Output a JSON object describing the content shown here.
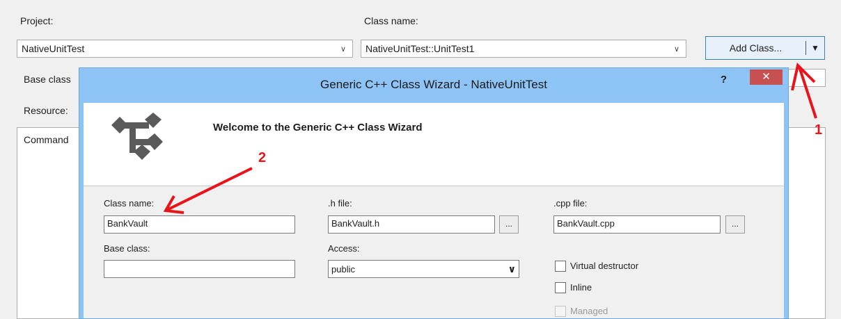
{
  "background": {
    "project_label": "Project:",
    "project_value": "NativeUnitTest",
    "classname_label": "Class name:",
    "classname_value": "NativeUnitTest::UnitTest1",
    "add_class_button": "Add Class...",
    "base_class_label": "Base class",
    "resource_label": "Resource:",
    "commands_label": "Command"
  },
  "dialog": {
    "title": "Generic C++ Class Wizard - NativeUnitTest",
    "help": "?",
    "close": "✕",
    "welcome": "Welcome to the Generic C++ Class Wizard",
    "class_name_label": "Class name:",
    "class_name_value": "BankVault",
    "h_file_label": ".h file:",
    "h_file_value": "BankVault.h",
    "cpp_file_label": ".cpp file:",
    "cpp_file_value": "BankVault.cpp",
    "browse": "...",
    "base_class_label": "Base class:",
    "base_class_value": "",
    "access_label": "Access:",
    "access_value": "public",
    "virtual_destructor_label": "Virtual destructor",
    "inline_label": "Inline",
    "managed_label": "Managed"
  },
  "annotations": {
    "marker1": "1",
    "marker2": "2"
  },
  "colors": {
    "annotation": "#e8141c",
    "dialog_frame": "#8dc4f5",
    "close_button": "#c75050"
  }
}
